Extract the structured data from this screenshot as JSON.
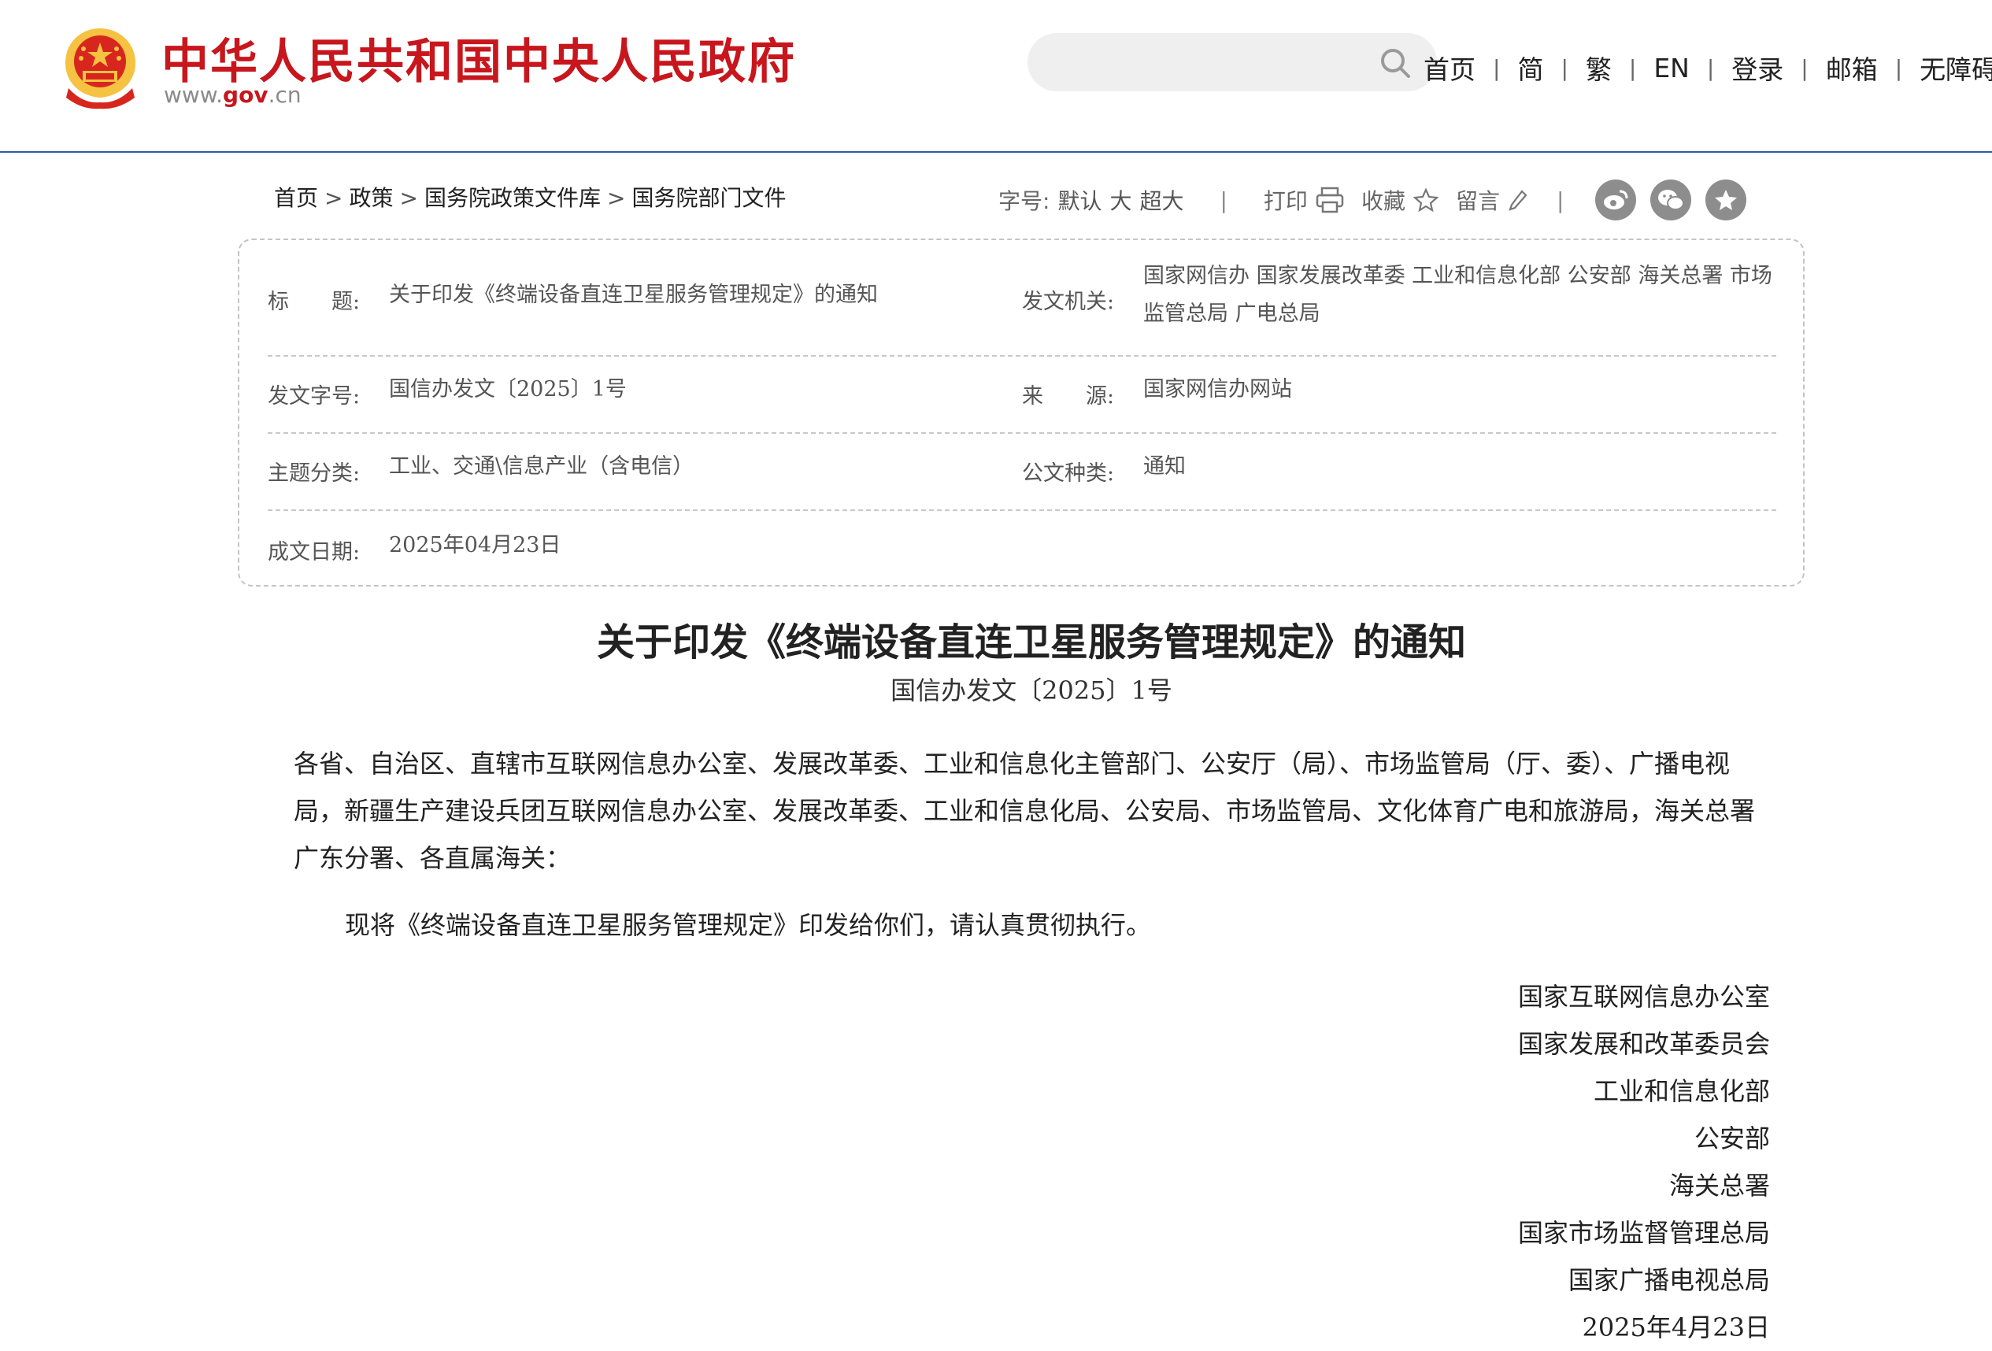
{
  "header": {
    "site_title": "中华人民共和国中央人民政府",
    "url_prefix": "www.",
    "url_domain": "gov",
    "url_suffix": ".cn",
    "nav": [
      "首页",
      "简",
      "繁",
      "EN",
      "登录",
      "邮箱",
      "无障碍"
    ]
  },
  "breadcrumb": [
    "首页",
    "政策",
    "国务院政策文件库",
    "国务院部门文件"
  ],
  "tools": {
    "font_label": "字号:",
    "font_default": "默认",
    "font_large": "大",
    "font_xlarge": "超大",
    "print": "打印",
    "favorite": "收藏",
    "comment": "留言",
    "share_icons": [
      "weibo-icon",
      "wechat-icon",
      "qzone-icon"
    ]
  },
  "info": {
    "title_label": "标　　题:",
    "title_value": "关于印发《终端设备直连卫星服务管理规定》的通知",
    "issuer_label": "发文机关:",
    "issuer_value": "国家网信办 国家发展改革委 工业和信息化部 公安部 海关总署 市场监管总局 广电总局",
    "docno_label": "发文字号:",
    "docno_value": "国信办发文〔2025〕1号",
    "source_label": "来　　源:",
    "source_value": "国家网信办网站",
    "topic_label": "主题分类:",
    "topic_value": "工业、交通\\信息产业（含电信）",
    "type_label": "公文种类:",
    "type_value": "通知",
    "date_label": "成文日期:",
    "date_value": "2025年04月23日"
  },
  "document": {
    "title": "关于印发《终端设备直连卫星服务管理规定》的通知",
    "number": "国信办发文〔2025〕1号",
    "recipients": "各省、自治区、直辖市互联网信息办公室、发展改革委、工业和信息化主管部门、公安厅（局）、市场监管局（厅、委）、广播电视局，新疆生产建设兵团互联网信息办公室、发展改革委、工业和信息化局、公安局、市场监管局、文化体育广电和旅游局，海关总署广东分署、各直属海关：",
    "body": "现将《终端设备直连卫星服务管理规定》印发给你们，请认真贯彻执行。",
    "signers": [
      "国家互联网信息办公室",
      "国家发展和改革委员会",
      "工业和信息化部",
      "公安部",
      "海关总署",
      "国家市场监督管理总局",
      "国家广播电视总局"
    ],
    "date": "2025年4月23日"
  },
  "colors": {
    "brand_red": "#c8161d",
    "link_blue": "#2e5aa8",
    "icon_gray": "#8d8d8d"
  }
}
